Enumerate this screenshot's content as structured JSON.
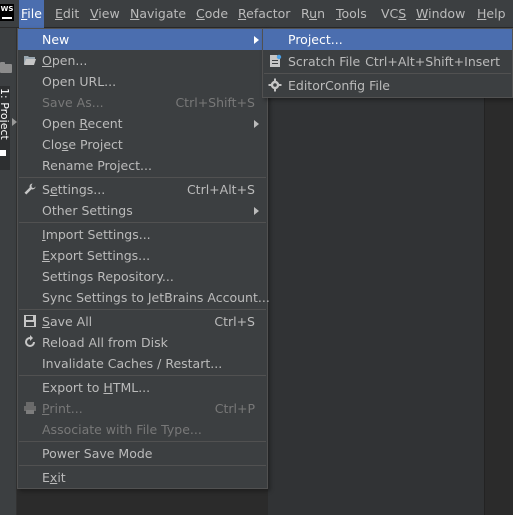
{
  "app": {
    "logo_text": "WS"
  },
  "menubar": {
    "items": [
      {
        "label": "File",
        "mnemonic": "F",
        "rest": "ile",
        "active": true
      },
      {
        "label": "Edit",
        "mnemonic": "E",
        "rest": "dit"
      },
      {
        "label": "View",
        "mnemonic": "V",
        "rest": "iew"
      },
      {
        "label": "Navigate",
        "mnemonic": "N",
        "rest": "avigate"
      },
      {
        "label": "Code",
        "mnemonic": "C",
        "rest": "ode"
      },
      {
        "label": "Refactor",
        "mnemonic": "R",
        "rest": "efactor"
      },
      {
        "label": "Run",
        "pre": "R",
        "mnemonic": "u",
        "rest": "n"
      },
      {
        "label": "Tools",
        "mnemonic": "T",
        "rest": "ools"
      },
      {
        "label": "VCS",
        "pre": "VC",
        "mnemonic": "S",
        "rest": ""
      },
      {
        "label": "Window",
        "mnemonic": "W",
        "rest": "indow"
      },
      {
        "label": "Help",
        "mnemonic": "H",
        "rest": "elp"
      }
    ]
  },
  "project_tab": {
    "label": "1: Project"
  },
  "file_menu": {
    "items": [
      {
        "id": "new",
        "label": "New",
        "submenu": true,
        "selected": true
      },
      {
        "id": "open",
        "label": "Open...",
        "mnemonic_index": 0,
        "icon": "folder-open-icon"
      },
      {
        "id": "open-url",
        "label": "Open URL..."
      },
      {
        "id": "save-as",
        "label": "Save As...",
        "shortcut": "Ctrl+Shift+S",
        "disabled": true
      },
      {
        "id": "open-recent",
        "label": "Open Recent",
        "mnemonic_index": 5,
        "submenu": true
      },
      {
        "id": "close-project",
        "label": "Close Project",
        "mnemonic_index": 3
      },
      {
        "id": "rename-project",
        "label": "Rename Project..."
      },
      {
        "id": "settings",
        "label": "Settings...",
        "mnemonic_index": 1,
        "shortcut": "Ctrl+Alt+S",
        "icon": "wrench-icon"
      },
      {
        "id": "other-settings",
        "label": "Other Settings",
        "submenu": true
      },
      {
        "id": "import-settings",
        "label": "Import Settings...",
        "mnemonic_index": 0
      },
      {
        "id": "export-settings",
        "label": "Export Settings...",
        "mnemonic_index": 0
      },
      {
        "id": "settings-repository",
        "label": "Settings Repository..."
      },
      {
        "id": "sync-settings",
        "label": "Sync Settings to JetBrains Account..."
      },
      {
        "id": "save-all",
        "label": "Save All",
        "mnemonic_index": 0,
        "shortcut": "Ctrl+S",
        "icon": "save-icon"
      },
      {
        "id": "reload-all",
        "label": "Reload All from Disk",
        "icon": "reload-icon"
      },
      {
        "id": "invalidate-caches",
        "label": "Invalidate Caches / Restart..."
      },
      {
        "id": "export-html",
        "label": "Export to HTML...",
        "mnemonic_index": 10
      },
      {
        "id": "print",
        "label": "Print...",
        "mnemonic_index": 0,
        "shortcut": "Ctrl+P",
        "disabled": true,
        "icon": "printer-icon"
      },
      {
        "id": "associate-file-type",
        "label": "Associate with File Type...",
        "disabled": true
      },
      {
        "id": "power-save-mode",
        "label": "Power Save Mode"
      },
      {
        "id": "exit",
        "label": "Exit",
        "mnemonic_index": 1
      }
    ]
  },
  "new_submenu": {
    "items": [
      {
        "id": "project",
        "label": "Project...",
        "selected": true
      },
      {
        "id": "scratch-file",
        "label": "Scratch File",
        "shortcut": "Ctrl+Alt+Shift+Insert",
        "icon": "scratch-file-icon"
      },
      {
        "id": "editorconfig-file",
        "label": "EditorConfig File",
        "icon": "gear-icon"
      }
    ]
  },
  "colors": {
    "background": "#2b2b2b",
    "menu_background": "#3c3f41",
    "selection": "#4b6eaf",
    "text": "#bbbbbb",
    "disabled_text": "#787878"
  }
}
